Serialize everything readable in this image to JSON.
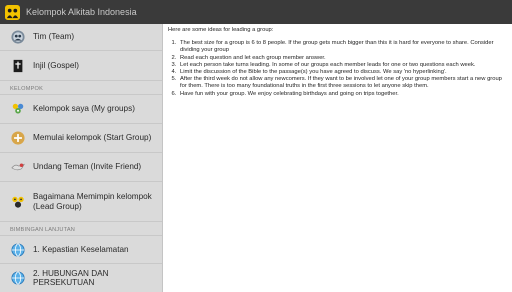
{
  "app": {
    "title": "Kelompok Alkitab Indonesia"
  },
  "sidebar": {
    "items": [
      {
        "label": "Tim (Team)",
        "icon": "team-icon"
      },
      {
        "label": "Injil (Gospel)",
        "icon": "bible-icon"
      }
    ],
    "section1": "KELOMPOK",
    "group_items": [
      {
        "label": "Kelompok saya (My groups)",
        "icon": "group-icon"
      },
      {
        "label": "Memulai kelompok (Start Group)",
        "icon": "plus-icon"
      },
      {
        "label": "Undang Teman (Invite Friend)",
        "icon": "invite-icon"
      },
      {
        "label": "Bagaimana Memimpin kelompok (Lead Group)",
        "icon": "lead-group-icon"
      }
    ],
    "section2": "BIMBINGAN LANJUTAN",
    "advanced_items": [
      {
        "label": "1. Kepastian Keselamatan",
        "icon": "globe-icon"
      },
      {
        "label": "2. HUBUNGAN DAN PERSEKUTUAN",
        "icon": "globe-icon"
      }
    ]
  },
  "content": {
    "intro": "Here are some ideas for leading a group:",
    "tips": [
      "The best size for a group is 6 to 8 people.  If the group gets much bigger than this it is hard for everyone to share.  Consider dividing your group",
      "Read each question and let each group member answer.",
      "Let each person take turns leading.  In some of our groups each member leads for one or two questions each week.",
      "Limit the discussion of the Bible to the passage(s) you have agreed to discuss.  We say 'no hyperlinking'.",
      "After the third week do not allow any newcomers.  If they want to be involved let one of your group members start a new group for them.  There is too many foundational truths in the first three sessions to let anyone skip them.",
      "Have fun with your group.  We enjoy celebrating birthdays and going on trips together."
    ]
  }
}
